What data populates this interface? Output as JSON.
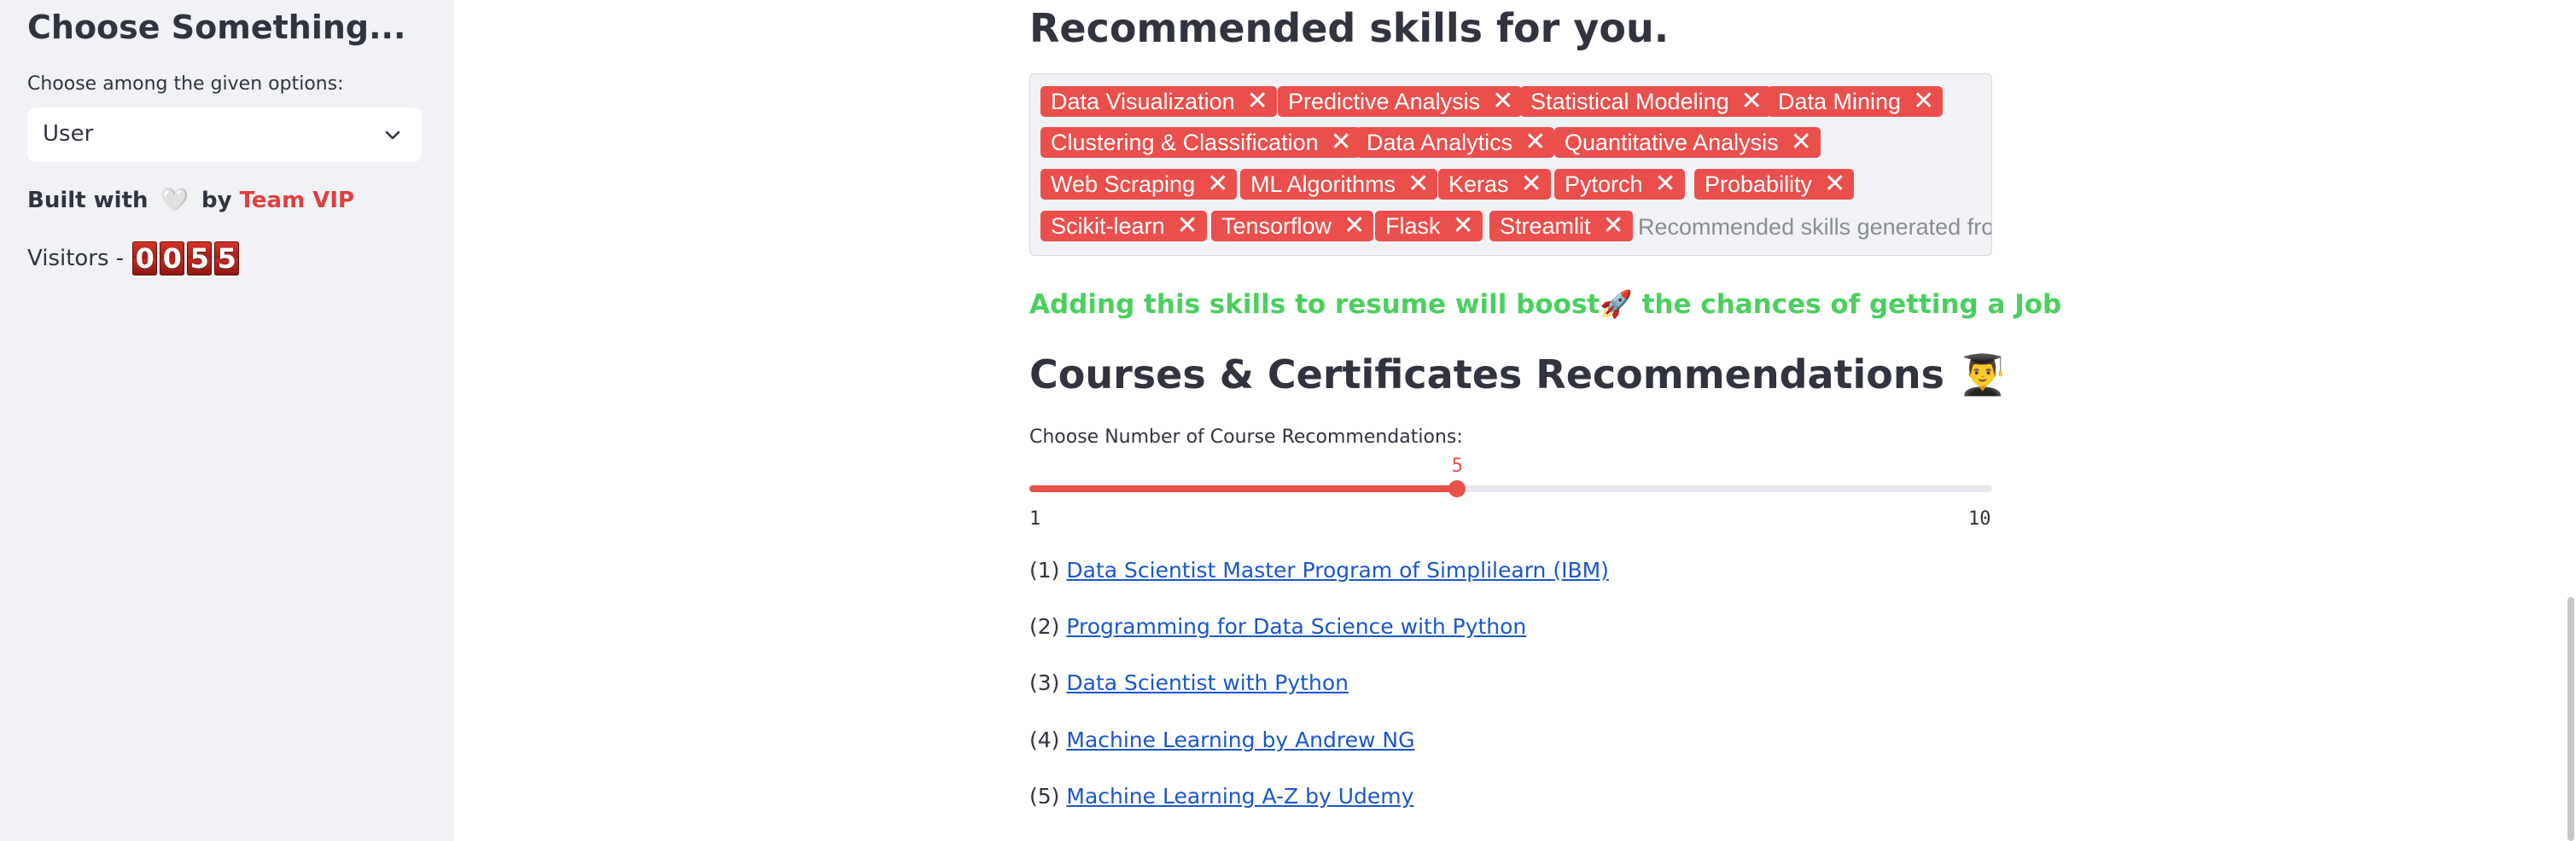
{
  "sidebar": {
    "title": "Choose Something...",
    "select_label": "Choose among the given options:",
    "select_value": "User",
    "built_prefix": "Built with",
    "built_heart": "🤍",
    "built_by": "by",
    "team": "Team VIP",
    "visitors_label": "Visitors -",
    "visitor_digits": [
      "0",
      "0",
      "5",
      "5"
    ]
  },
  "main": {
    "skills_heading": "Recommended skills for you.",
    "skills": [
      "Data Visualization",
      "Predictive Analysis",
      "Statistical Modeling",
      "Data Mining",
      "Clustering & Classification",
      "Data Analytics",
      "Quantitative Analysis",
      "Web Scraping",
      "ML Algorithms",
      "Keras",
      "Pytorch",
      "Probability",
      "Scikit-learn",
      "Tensorflow",
      "Flask",
      "Streamlit"
    ],
    "skills_placeholder": "Recommended skills generated from System",
    "boost_text": "Adding this skills to resume will boost🚀 the chances of getting a Job",
    "courses_heading": "Courses & Certificates Recommendations 👨‍🎓",
    "slider_label": "Choose Number of Course Recommendations:",
    "slider_value": "5",
    "slider_min": "1",
    "slider_max": "10",
    "courses": [
      {
        "num": "(1)",
        "title": "Data Scientist Master Program of Simplilearn (IBM)"
      },
      {
        "num": "(2)",
        "title": "Programming for Data Science with Python"
      },
      {
        "num": "(3)",
        "title": "Data Scientist with Python"
      },
      {
        "num": "(4)",
        "title": "Machine Learning by Andrew NG"
      },
      {
        "num": "(5)",
        "title": "Machine Learning A-Z by Udemy"
      }
    ]
  },
  "colors": {
    "accent": "#ea4f4c",
    "success_text": "#4bcf5e",
    "link": "#1a57c9",
    "sidebar_bg": "#f0f2f6"
  },
  "icons": {
    "select_chevron": "chevron-down-icon",
    "tag_remove": "close-icon"
  }
}
